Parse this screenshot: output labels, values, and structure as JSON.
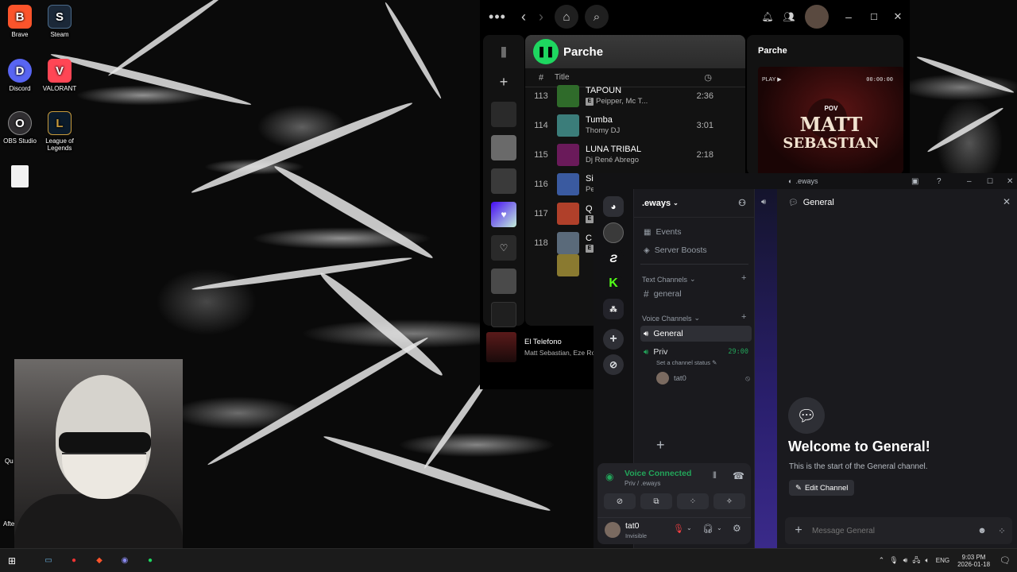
{
  "desktop": {
    "icons": [
      {
        "label": "Brave",
        "color": "#fb542b",
        "glyph": "B"
      },
      {
        "label": "Steam",
        "color": "#1b2838",
        "glyph": "S"
      },
      {
        "label": "Discord",
        "color": "#5865f2",
        "glyph": "D"
      },
      {
        "label": "VALORANT",
        "color": "#ff4655",
        "glyph": "V"
      },
      {
        "label": "OBS Studio",
        "color": "#302e31",
        "glyph": "O"
      },
      {
        "label": "League of Legends",
        "color": "#c89b3c",
        "glyph": "L"
      },
      {
        "label": "",
        "color": "#f2f2f2",
        "glyph": ""
      }
    ],
    "partial_labels": [
      "Qu",
      "Afte"
    ]
  },
  "spotify": {
    "playlist_title": "Parche",
    "col_number": "#",
    "col_title": "Title",
    "tracks": [
      {
        "num": "113",
        "title": "TAPOUN",
        "artist": "Peipper, Mc T...",
        "duration": "2:36",
        "explicit": true,
        "art": "#2f6b2a"
      },
      {
        "num": "114",
        "title": "Tumba",
        "artist": "Thomy DJ",
        "duration": "3:01",
        "explicit": false,
        "art": "#3b7d7a"
      },
      {
        "num": "115",
        "title": "LUNA TRIBAL",
        "artist": "Dj René Abrego",
        "duration": "2:18",
        "explicit": false,
        "art": "#6a1a5a"
      },
      {
        "num": "116",
        "title": "Si",
        "artist": "Pe",
        "duration": "",
        "explicit": false,
        "art": "#3a5aa0"
      },
      {
        "num": "117",
        "title": "Q",
        "artist": "",
        "duration": "",
        "explicit": true,
        "art": "#b0402a"
      },
      {
        "num": "118",
        "title": "C",
        "artist": "",
        "duration": "",
        "explicit": true,
        "art": "#5a6a7a"
      }
    ],
    "now_playing_panel": {
      "title": "Parche",
      "play_label": "PLAY ▶",
      "time": "00:00:00",
      "cover_line1": "POV",
      "cover_line2": "MATT",
      "cover_line3": "SEBASTIAN"
    },
    "player": {
      "title": "El Telefono",
      "artist": "Matt Sebastian, Eze Ro"
    },
    "accent": "#1ed760"
  },
  "discord": {
    "window_title": ".eways",
    "server_name": ".eways",
    "items": [
      "Events",
      "Server Boosts"
    ],
    "text_category": "Text Channels",
    "text_channels": [
      "general"
    ],
    "voice_category": "Voice Channels",
    "voice_channels": [
      {
        "name": "General",
        "active": true
      },
      {
        "name": "Priv",
        "time": "29:00",
        "status": "Set a channel status"
      }
    ],
    "voice_member": "tat0",
    "voice_status": {
      "title": "Voice Connected",
      "subtitle": "Priv / .eways"
    },
    "user": {
      "name": "tat0",
      "status": "Invisible"
    },
    "channel_header": "General",
    "welcome_title": "Welcome to General!",
    "welcome_sub": "This is the start of the General channel.",
    "edit_channel": "Edit Channel",
    "message_placeholder": "Message General",
    "accent": "#5865f2",
    "green": "#23a55a"
  },
  "taskbar": {
    "language": "ENG",
    "time": "9:03 PM",
    "date": "2026-01-18"
  }
}
